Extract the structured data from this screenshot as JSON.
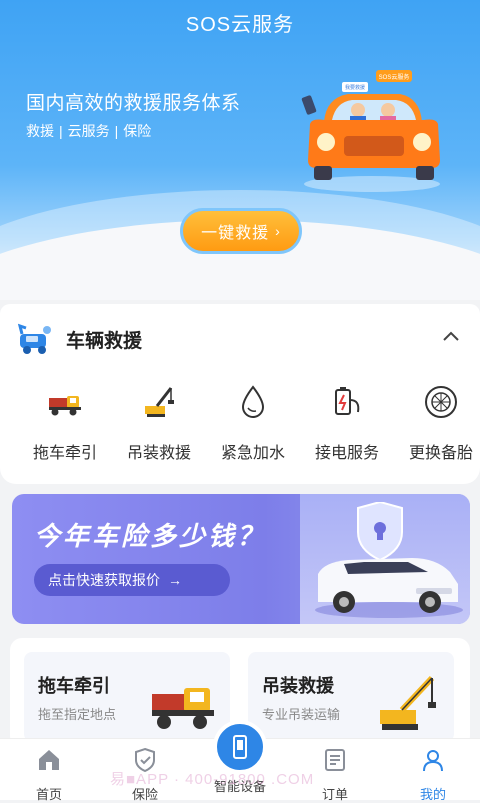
{
  "header": {
    "title": "SOS云服务"
  },
  "hero": {
    "headline": "国内高效的救援服务体系",
    "tags": [
      "救援",
      "云服务",
      "保险"
    ],
    "tag_separator": "|",
    "button_label": "一键救援",
    "button_chevron": "›",
    "illustration_badge": "SOS云服务",
    "illustration_sign": "我要救援"
  },
  "vehicle_section": {
    "title": "车辆救援",
    "collapse_icon": "chevron-up-icon",
    "services": [
      {
        "label": "拖车牵引",
        "icon": "tow-truck-icon"
      },
      {
        "label": "吊装救援",
        "icon": "crane-icon"
      },
      {
        "label": "紧急加水",
        "icon": "water-drop-icon"
      },
      {
        "label": "接电服务",
        "icon": "battery-plug-icon"
      },
      {
        "label": "更换备胎",
        "icon": "tire-icon"
      }
    ]
  },
  "banner": {
    "title": "今年车险多少钱？",
    "button_label": "点击快速获取报价",
    "button_arrow": "→"
  },
  "cards": [
    {
      "title": "拖车牵引",
      "subtitle": "拖至指定地点",
      "icon": "tow-truck-icon"
    },
    {
      "title": "吊装救援",
      "subtitle": "专业吊装运输",
      "icon": "crane-icon"
    }
  ],
  "tabbar": {
    "tabs": [
      {
        "label": "首页",
        "icon": "home-icon"
      },
      {
        "label": "保险",
        "icon": "shield-check-icon"
      },
      {
        "label": "智能设备",
        "icon": "device-icon"
      },
      {
        "label": "订单",
        "icon": "order-icon"
      },
      {
        "label": "我的",
        "icon": "user-icon"
      }
    ],
    "active_index": 4
  },
  "watermark": "易■APP · 400-91800 .COM",
  "colors": {
    "primary": "#2e86e6",
    "accent": "#ff9b12",
    "banner": "#8e8ef2"
  }
}
